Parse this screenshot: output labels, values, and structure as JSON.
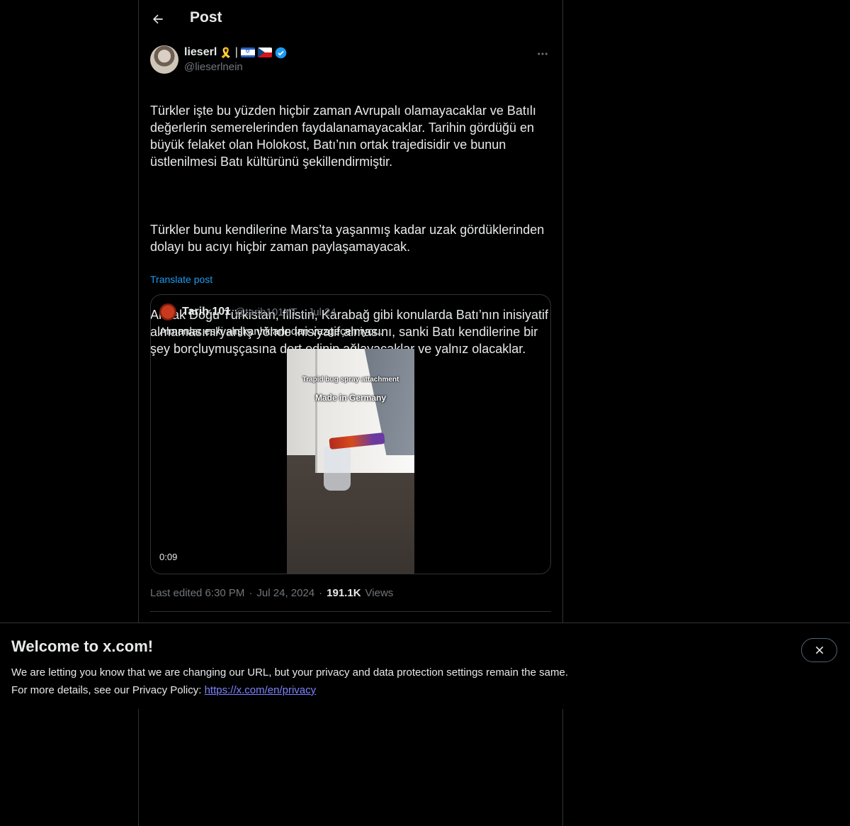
{
  "header": {
    "title": "Post"
  },
  "author": {
    "name": "lieserl",
    "emojis": [
      "🎗️",
      "|"
    ],
    "handle": "@lieserlnein"
  },
  "post": {
    "paragraphs": [
      "Türkler işte bu yüzden hiçbir zaman Avrupalı olamayacaklar ve Batılı değerlerin semerelerinden faydalanamayacaklar. Tarihin gördüğü en büyük felaket olan Holokost, Batı’nın ortak trajedisidir ve bunun üstlenilmesi Batı kültürünü şekillendirmiştir.",
      "Türkler bunu kendilerine Mars’ta yaşanmış kadar uzak gördüklerinden dolayı bu acıyı hiçbir zaman paylaşamayacak.",
      "Ancak Doğu Türkistan, filistin, Karabağ gibi konularda Batı’nın inisiyatif almamasını/yanlış yönde inisiyatif almasını, sanki Batı kendilerine bir şey borçluymuşçasına dert edinip ağlayacaklar ve yalnız olacaklar."
    ],
    "translate_label": "Translate post"
  },
  "quote": {
    "name": "Tarih 101",
    "handle": "@tarih101YT",
    "dot": "·",
    "date": "Jul 24",
    "text": "Almanlar eski alışkanlıklarından vazgeçemiyor..",
    "video_caption_1": "Trapid bug spray attachment",
    "video_caption_2": "Made in Germany",
    "duration": "0:09"
  },
  "meta": {
    "edited": "Last edited 6:30 PM",
    "dot1": "·",
    "date": "Jul 24, 2024",
    "dot2": "·",
    "views_count": "191.1K",
    "views_label": "Views"
  },
  "banner": {
    "title": "Welcome to x.com!",
    "line1": "We are letting you know that we are changing our URL, but your privacy and data protection settings remain the same.",
    "line2_prefix": "For more details, see our Privacy Policy: ",
    "link": "https://x.com/en/privacy"
  },
  "colors": {
    "background": "#000000",
    "text": "#e7e9ea",
    "muted": "#71767b",
    "accent": "#1d9bf0",
    "link": "#7e84ff"
  }
}
